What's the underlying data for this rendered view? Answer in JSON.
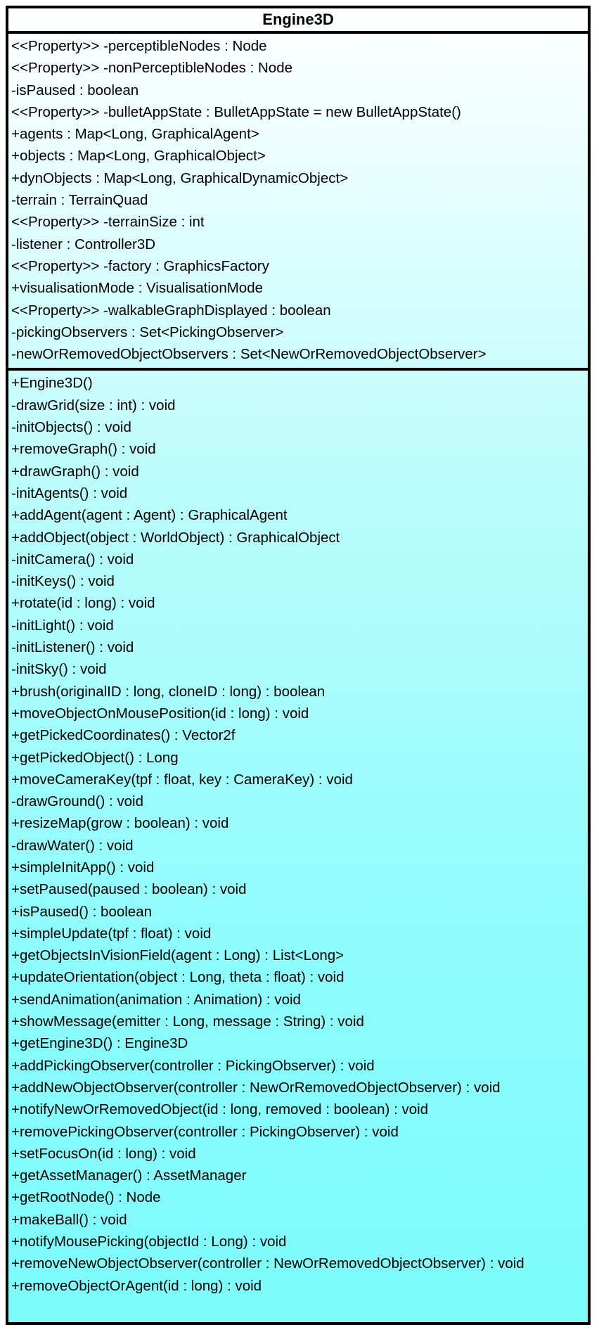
{
  "class": {
    "name": "Engine3D",
    "attributes": [
      "<<Property>> -perceptibleNodes : Node",
      "<<Property>> -nonPerceptibleNodes : Node",
      "-isPaused : boolean",
      "<<Property>> -bulletAppState : BulletAppState = new BulletAppState()",
      "+agents : Map<Long, GraphicalAgent>",
      "+objects : Map<Long, GraphicalObject>",
      "+dynObjects : Map<Long, GraphicalDynamicObject>",
      "-terrain : TerrainQuad",
      "<<Property>> -terrainSize : int",
      "-listener : Controller3D",
      "<<Property>> -factory : GraphicsFactory",
      "+visualisationMode : VisualisationMode",
      "<<Property>> -walkableGraphDisplayed : boolean",
      "-pickingObservers : Set<PickingObserver>",
      "-newOrRemovedObjectObservers : Set<NewOrRemovedObjectObserver>"
    ],
    "operations": [
      "+Engine3D()",
      "-drawGrid(size : int) : void",
      "-initObjects() : void",
      "+removeGraph() : void",
      "+drawGraph() : void",
      "-initAgents() : void",
      "+addAgent(agent : Agent) : GraphicalAgent",
      "+addObject(object : WorldObject) : GraphicalObject",
      "-initCamera() : void",
      "-initKeys() : void",
      "+rotate(id : long) : void",
      "-initLight() : void",
      "-initListener() : void",
      "-initSky() : void",
      "+brush(originalID : long, cloneID : long) : boolean",
      "+moveObjectOnMousePosition(id : long) : void",
      "+getPickedCoordinates() : Vector2f",
      "+getPickedObject() : Long",
      "+moveCameraKey(tpf : float, key : CameraKey) : void",
      "-drawGround() : void",
      "+resizeMap(grow : boolean) : void",
      "-drawWater() : void",
      "+simpleInitApp() : void",
      "+setPaused(paused : boolean) : void",
      "+isPaused() : boolean",
      "+simpleUpdate(tpf : float) : void",
      "+getObjectsInVisionField(agent : Long) : List<Long>",
      "+updateOrientation(object : Long, theta : float) : void",
      "+sendAnimation(animation : Animation) : void",
      "+showMessage(emitter : Long, message : String) : void",
      "+getEngine3D() : Engine3D",
      "+addPickingObserver(controller : PickingObserver) : void",
      "+addNewObjectObserver(controller : NewOrRemovedObjectObserver) : void",
      "+notifyNewOrRemovedObject(id : long, removed : boolean) : void",
      "+removePickingObserver(controller : PickingObserver) : void",
      "+setFocusOn(id : long) : void",
      "+getAssetManager() : AssetManager",
      "+getRootNode() : Node",
      "+makeBall() : void",
      "+notifyMousePicking(objectId : Long) : void",
      "+removeNewObjectObserver(controller : NewOrRemovedObjectObserver) : void",
      "+removeObjectOrAgent(id : long) : void"
    ]
  },
  "colors": {
    "border": "#000000",
    "gradient_top": "#ffffff",
    "gradient_bottom": "#7cfbfb"
  }
}
